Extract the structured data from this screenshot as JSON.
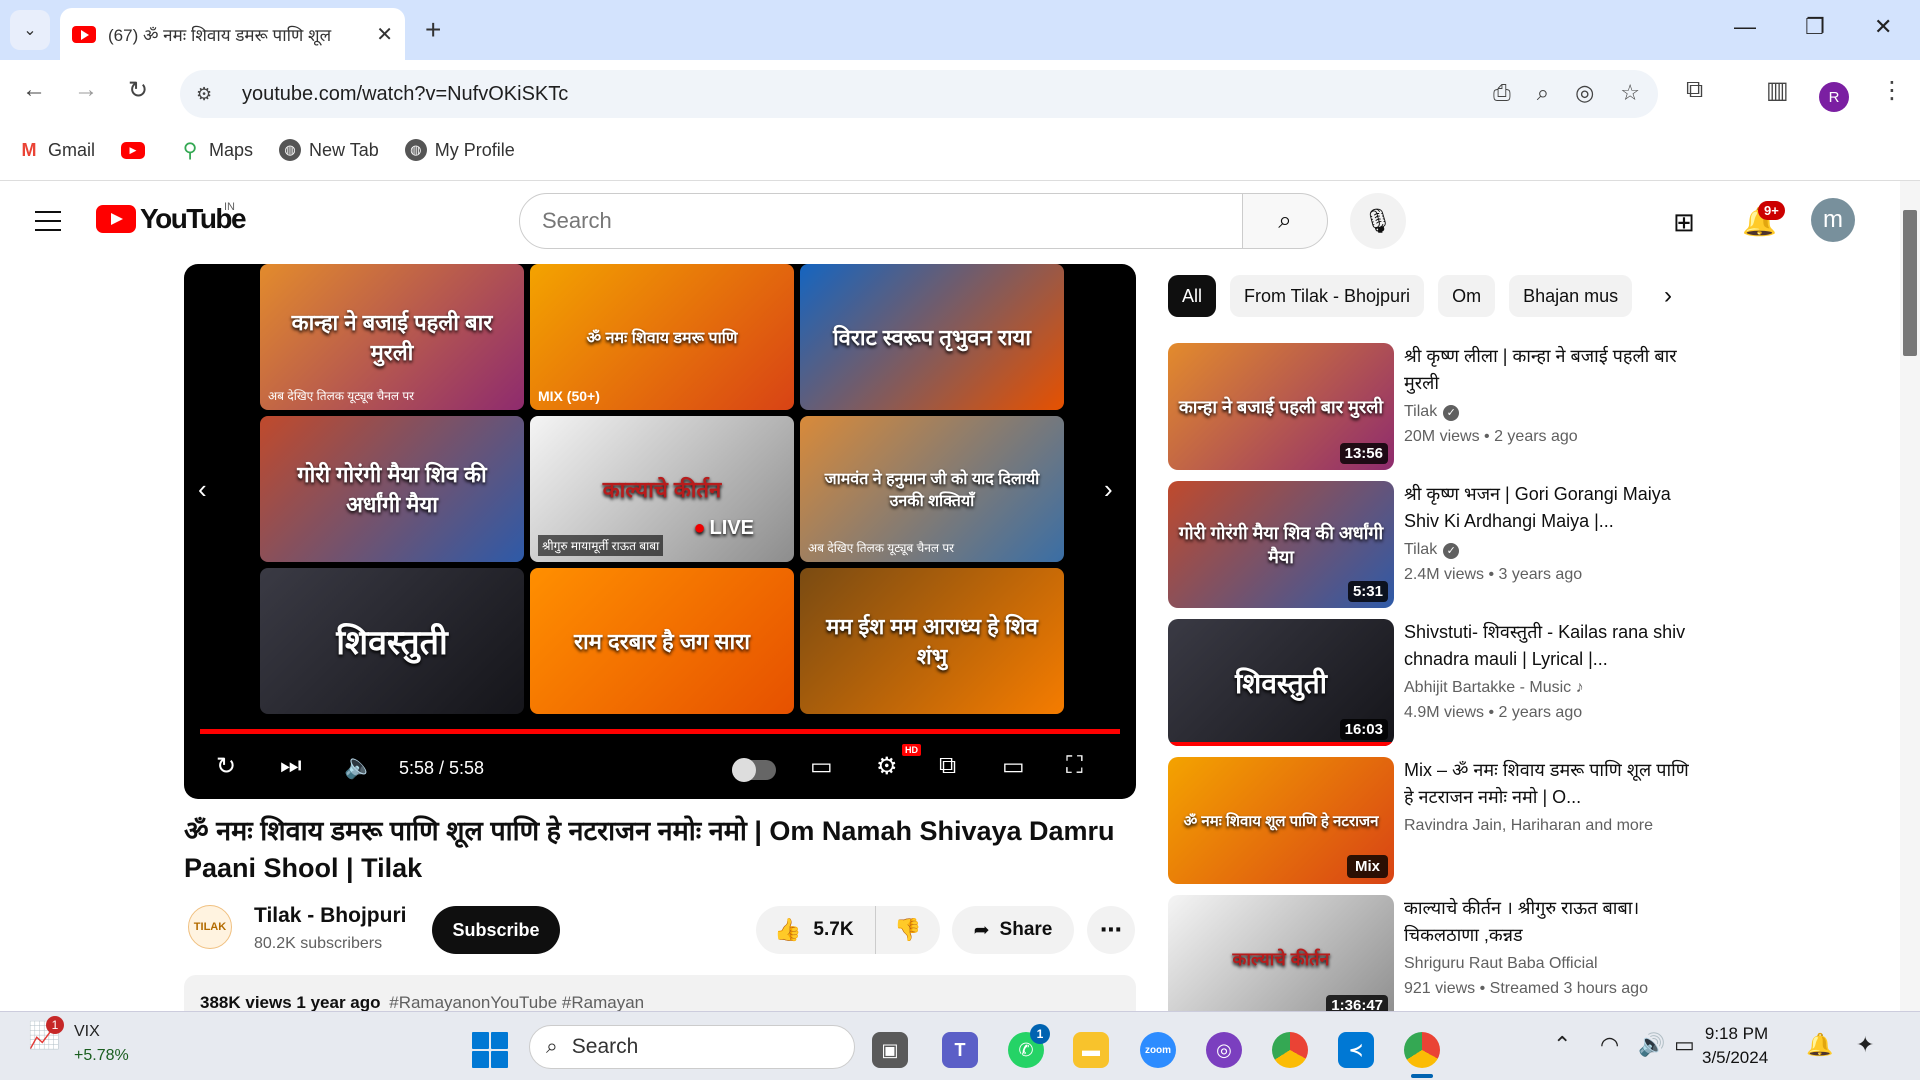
{
  "browser": {
    "tab_title": "(67) ॐ नमः शिवाय डमरू पाणि शूल",
    "url": "youtube.com/watch?v=NufvOKiSKTc",
    "profile_initial": "R",
    "bookmarks": [
      {
        "label": "Gmail"
      },
      {
        "label": ""
      },
      {
        "label": "Maps"
      },
      {
        "label": "New Tab"
      },
      {
        "label": "My Profile"
      }
    ]
  },
  "youtube": {
    "logo_text": "YouTube",
    "region": "IN",
    "search_placeholder": "Search",
    "notification_count": "9+",
    "avatar_initial": "m"
  },
  "player": {
    "end_screen": [
      {
        "text": "कान्हा ने बजाई पहली बार मुरली",
        "sub": "अब देखिए तिलक यूट्यूब चैनल पर",
        "bg": "#8e2b6e"
      },
      {
        "text": "ॐ नमः शिवाय डमरू पाणि",
        "sub": "MIX (50+)",
        "bg": "#d84315"
      },
      {
        "text": "विराट स्वरूप तृभुवन राया",
        "sub": "",
        "bg": "#1565c0"
      },
      {
        "text": "गोरी गोरंगी मैया शिव की अर्धांगी मैया",
        "sub": "",
        "bg": "#2e5aa8"
      },
      {
        "text": "काल्याचे कीर्तन",
        "sub": "श्रीगुरु मायामूर्ती राऊत बाबा",
        "bg": "#8d8d8d",
        "live": "LIVE"
      },
      {
        "text": "जामवंत ने हनुमान जी को याद दिलायी उनकी शक्तियाँ",
        "sub": "अब देखिए तिलक यूट्यूब चैनल पर",
        "bg": "#3a6ea5"
      },
      {
        "text": "शिवस्तुती",
        "sub": "",
        "bg": "#2b2b33"
      },
      {
        "text": "राम दरबार है जग सारा",
        "sub": "",
        "bg": "#e65100"
      },
      {
        "text": "मम ईश मम आराध्य हे शिव शंभु",
        "sub": "",
        "bg": "#a15c12"
      }
    ],
    "time": "5:58 / 5:58",
    "hd": "HD",
    "progress": 1.0
  },
  "video": {
    "title": "ॐ नमः शिवाय डमरू पाणि शूल पाणि हे नटराजन नमोः नमो | Om Namah Shivaya Damru Paani Shool | Tilak",
    "channel_logo": "TILAK",
    "channel": "Tilak - Bhojpuri",
    "subscribers": "80.2K subscribers",
    "subscribe_label": "Subscribe",
    "likes": "5.7K",
    "share_label": "Share",
    "views_line": "388K views  1 year ago",
    "hashtags": "#RamayanonYouTube #Ramayan"
  },
  "chips": [
    "All",
    "From Tilak - Bhojpuri",
    "Om",
    "Bhajan mus"
  ],
  "related": [
    {
      "thumb_text": "कान्हा ने बजाई पहली बार मुरली",
      "thumb_bg": "#8e2b6e",
      "duration": "13:56",
      "title": "श्री कृष्ण लीला | कान्हा ने बजाई पहली बार मुरली",
      "channel": "Tilak",
      "meta": "20M views  •  2 years ago",
      "verified": true
    },
    {
      "thumb_text": "गोरी गोरंगी मैया शिव की अर्धांगी मैया",
      "thumb_bg": "#2e5aa8",
      "duration": "5:31",
      "title": "श्री कृष्ण भजन | Gori Gorangi Maiya Shiv Ki Ardhangi Maiya |...",
      "channel": "Tilak",
      "meta": "2.4M views  •  3 years ago",
      "verified": true
    },
    {
      "thumb_text": "शिवस्तुती",
      "thumb_bg": "#2b2b33",
      "duration": "16:03",
      "title": "Shivstuti- शिवस्तुती - Kailas rana shiv chnadra mauli | Lyrical |...",
      "channel": "Abhijit Bartakke - Music ♪",
      "meta": "4.9M views  •  2 years ago",
      "verified": false,
      "redbar": true
    },
    {
      "thumb_text": "ॐ नमः शिवाय शूल पाणि हे नटराजन",
      "thumb_bg": "#d84315",
      "mix": "Mix",
      "title": "Mix – ॐ नमः शिवाय डमरू पाणि शूल पाणि हे नटराजन नमोः नमो | O...",
      "channel": "Ravindra Jain, Hariharan and more",
      "meta": "",
      "verified": false
    },
    {
      "thumb_text": "काल्याचे कीर्तन",
      "thumb_bg": "#8d8d8d",
      "duration": "1:36:47",
      "title": "काल्याचे कीर्तन । श्रीगुरु राऊत बाबा। चिकलठाणा ,कन्नड",
      "channel": "Shriguru Raut Baba Official",
      "meta": "921 views  •  Streamed 3 hours ago",
      "verified": false
    }
  ],
  "taskbar": {
    "widget_name": "VIX",
    "widget_change": "+5.78%",
    "widget_badge": "1",
    "search_label": "Search",
    "teams_badge": "1",
    "zoom_label": "zoom",
    "time": "9:18 PM",
    "date": "3/5/2024"
  }
}
